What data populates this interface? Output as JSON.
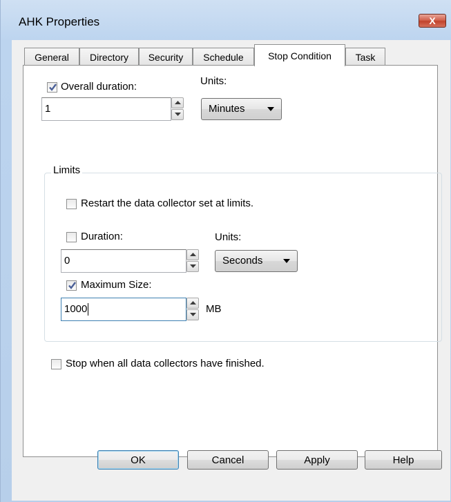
{
  "window": {
    "title": "AHK Properties",
    "close_label": "X"
  },
  "tabs": [
    {
      "label": "General",
      "active": false
    },
    {
      "label": "Directory",
      "active": false
    },
    {
      "label": "Security",
      "active": false
    },
    {
      "label": "Schedule",
      "active": false
    },
    {
      "label": "Stop Condition",
      "active": true
    },
    {
      "label": "Task",
      "active": false
    }
  ],
  "overall": {
    "checkbox_label": "Overall duration:",
    "checked": true,
    "value": "1",
    "units_label": "Units:",
    "units_value": "Minutes"
  },
  "limits": {
    "title": "Limits",
    "restart_label": "Restart the data collector set at limits.",
    "restart_checked": false,
    "duration_label": "Duration:",
    "duration_checked": false,
    "duration_value": "0",
    "units_label": "Units:",
    "units_value": "Seconds",
    "maxsize_label": "Maximum Size:",
    "maxsize_checked": true,
    "maxsize_value": "1000",
    "maxsize_unit": "MB"
  },
  "stop_all": {
    "label": "Stop when all data collectors have finished.",
    "checked": false
  },
  "buttons": {
    "ok": "OK",
    "cancel": "Cancel",
    "apply": "Apply",
    "help": "Help"
  },
  "colors": {
    "check_mark": "#4a5f97",
    "close_button": "#c1432c"
  }
}
